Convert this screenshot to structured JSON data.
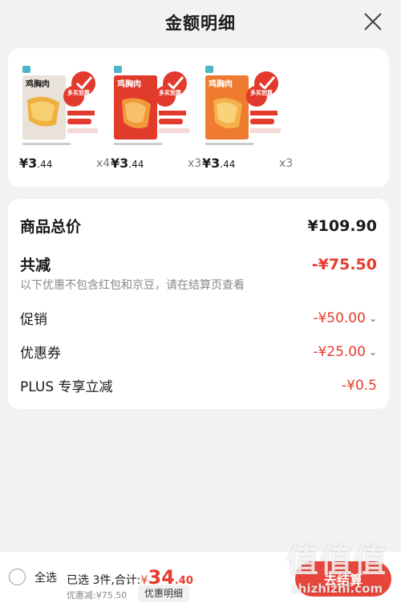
{
  "header": {
    "title": "金额明细"
  },
  "products": [
    {
      "name": "鸡胸肉",
      "badge": "多买划算",
      "price_int": "¥3",
      "price_dec": ".44",
      "qty": "x4",
      "bag_color": "#e8e2d8"
    },
    {
      "name": "鸡胸肉",
      "badge": "多买划算",
      "price_int": "¥3",
      "price_dec": ".44",
      "qty": "x3",
      "bag_color": "#e13b2c"
    },
    {
      "name": "鸡胸肉",
      "badge": "多买划算",
      "price_int": "¥3",
      "price_dec": ".44",
      "qty": "x3",
      "bag_color": "#ee7b2f"
    }
  ],
  "summary": {
    "total_label": "商品总价",
    "total_value": "¥109.90",
    "reduce_label": "共减",
    "reduce_value": "-¥75.50",
    "note": "以下优惠不包含红包和京豆，请在结算页查看",
    "promo_label": "促销",
    "promo_value": "-¥50.00",
    "coupon_label": "优惠券",
    "coupon_value": "-¥25.00",
    "plus_label": "PLUS 专享立减",
    "plus_value": "-¥0.5"
  },
  "bottom": {
    "select_all": "全选",
    "selected_text": "已选 3件,合计:",
    "amount_symbol": "¥",
    "amount_int": "34",
    "amount_dec": ".40",
    "discount_text": "优惠减:¥75.50",
    "detail_tab": "优惠明细",
    "checkout": "去结算"
  },
  "watermark": {
    "main": "值值值",
    "sub": "zhizhizhi.com"
  },
  "colors": {
    "accent": "#e63b2e",
    "background": "#f2f2f2"
  }
}
